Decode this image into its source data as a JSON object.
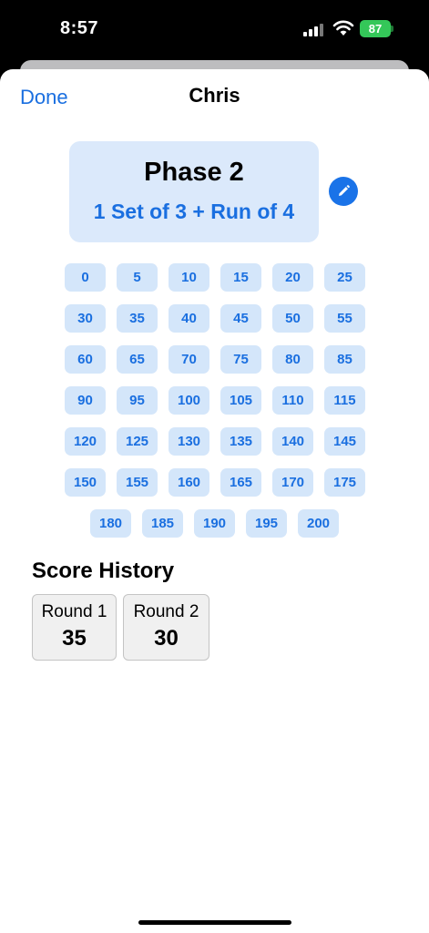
{
  "status": {
    "time": "8:57",
    "battery": "87"
  },
  "header": {
    "done_label": "Done",
    "title": "Chris"
  },
  "phase": {
    "title": "Phase 2",
    "description": "1 Set of 3 + Run of 4"
  },
  "icons": {
    "edit": "pencil-icon"
  },
  "scores": [
    "0",
    "5",
    "10",
    "15",
    "20",
    "25",
    "30",
    "35",
    "40",
    "45",
    "50",
    "55",
    "60",
    "65",
    "70",
    "75",
    "80",
    "85",
    "90",
    "95",
    "100",
    "105",
    "110",
    "115",
    "120",
    "125",
    "130",
    "135",
    "140",
    "145",
    "150",
    "155",
    "160",
    "165",
    "170",
    "175",
    "180",
    "185",
    "190",
    "195",
    "200"
  ],
  "history": {
    "title": "Score History",
    "rounds": [
      {
        "label": "Round 1",
        "score": "35"
      },
      {
        "label": "Round 2",
        "score": "30"
      }
    ]
  },
  "colors": {
    "accent": "#1a6fe0",
    "chip_bg": "#d4e6fa",
    "card_bg": "#dbe9fb",
    "battery": "#34c759"
  }
}
